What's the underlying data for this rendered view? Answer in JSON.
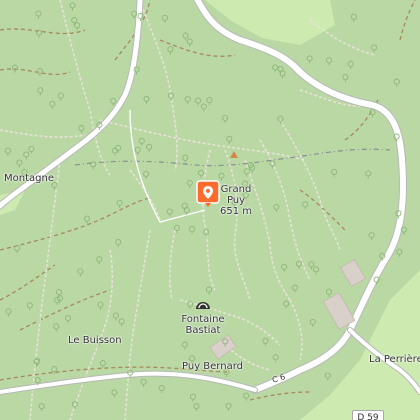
{
  "map": {
    "colors": {
      "forest": "#b9d8a4",
      "meadow": "#cdebb0",
      "road": "#ffffff",
      "road_casing": "#b8b8b8",
      "track": "#a7895d",
      "path": "#e8e2d8",
      "marker": "#ff6a2e"
    },
    "labels": {
      "montagne": "Montagne",
      "grand_puy_name": "Grand Puy",
      "grand_puy_line1": "Grand",
      "grand_puy_line2": "Puy",
      "grand_puy_elevation": "651 m",
      "fontaine_line1": "Fontaine",
      "fontaine_line2": "Bastiat",
      "le_buisson": "Le Buisson",
      "puy_bernard": "Puy Bernard",
      "la_perriere": "La Perrière",
      "road_c6": "C 6",
      "road_d": "D 59"
    },
    "marker": {
      "name": "Grand Puy",
      "icon": "map-pin-icon"
    },
    "icons": {
      "peak": "peak-triangle-icon",
      "spring": "spring-icon",
      "tree": "tree-icon"
    }
  }
}
